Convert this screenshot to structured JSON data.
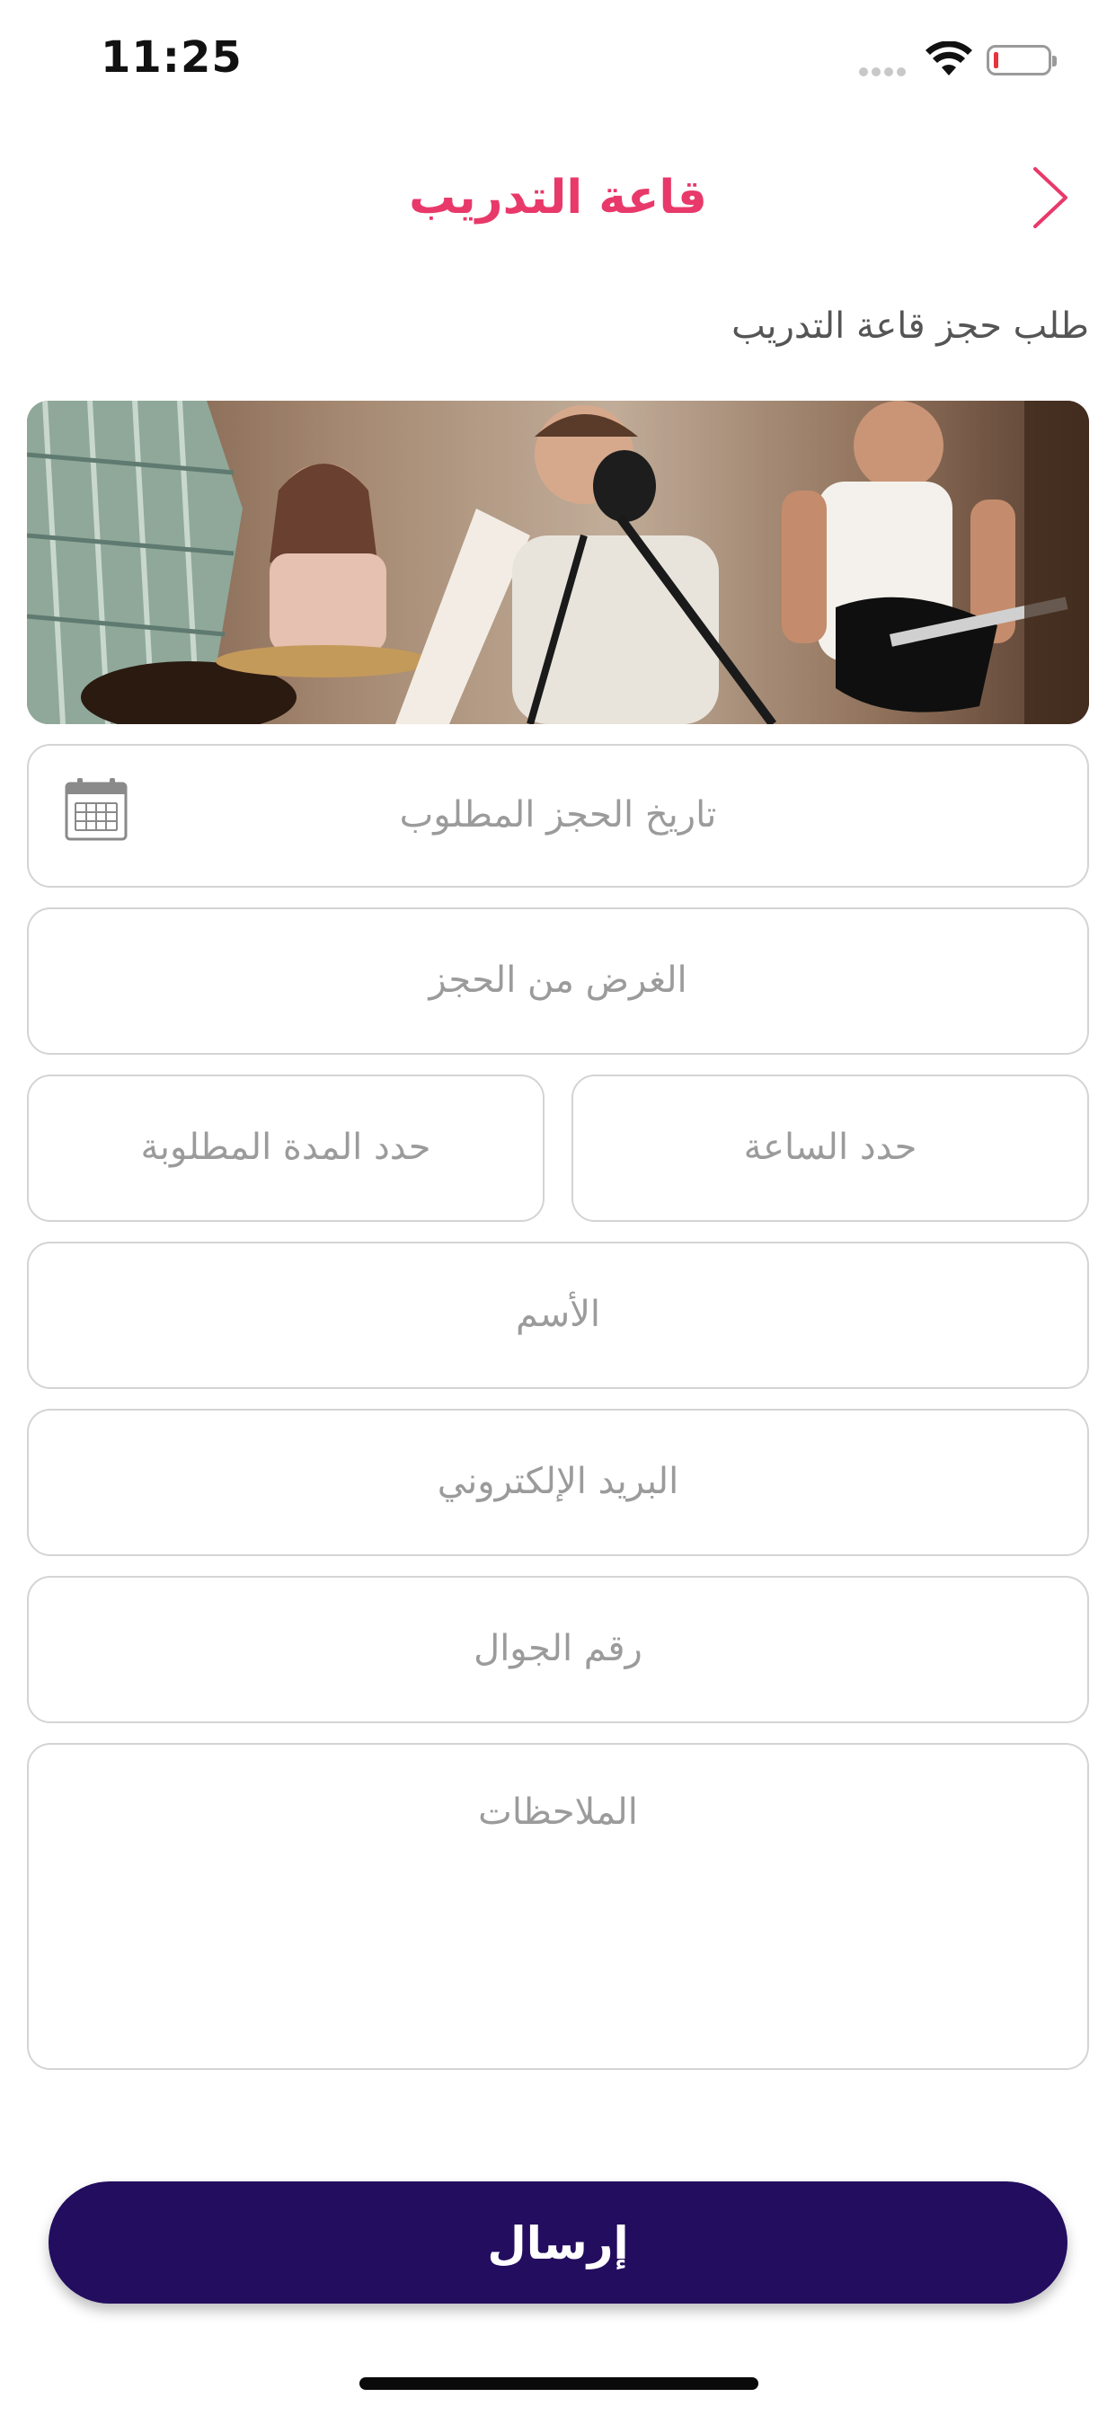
{
  "status": {
    "time": "11:25"
  },
  "header": {
    "title": "قاعة التدريب"
  },
  "subtitle": "طلب حجز قاعة التدريب",
  "form": {
    "date_placeholder": "تاريخ الحجز المطلوب",
    "purpose_placeholder": "الغرض من الحجز",
    "hour_placeholder": "حدد الساعة",
    "duration_placeholder": "حدد المدة المطلوبة",
    "name_placeholder": "الأسم",
    "email_placeholder": "البريد الإلكتروني",
    "phone_placeholder": "رقم الجوال",
    "notes_placeholder": "الملاحظات"
  },
  "submit_label": "إرسال",
  "colors": {
    "accent": "#e8396a",
    "button": "#230d5f",
    "field_border": "#d4d4d4"
  },
  "icons": [
    "wifi-icon",
    "battery-icon",
    "chevron-right-icon",
    "calendar-icon"
  ]
}
